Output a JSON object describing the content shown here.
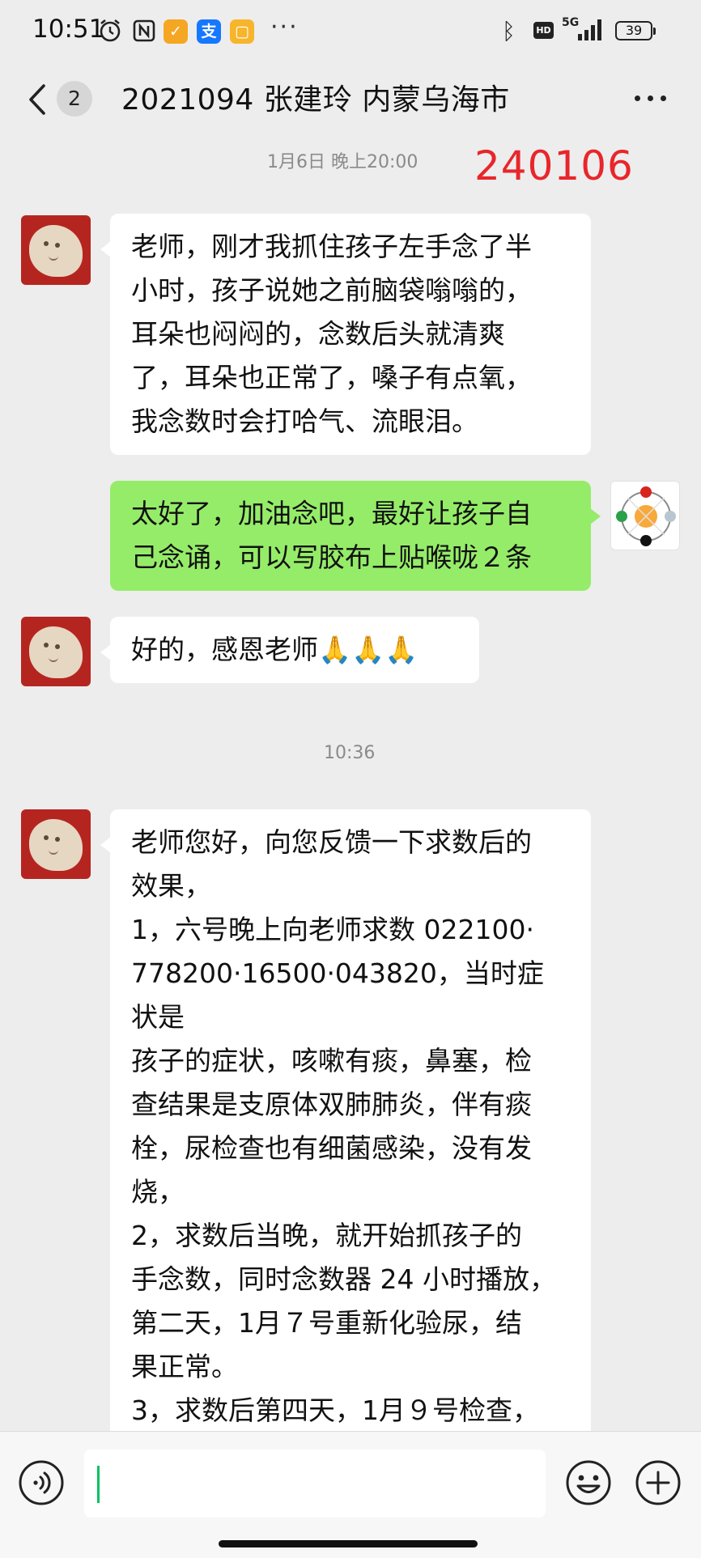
{
  "status_bar": {
    "time": "10:51",
    "app_badge_1": "✓",
    "app_badge_2": "支",
    "app_badge_3": "▢",
    "more": "···",
    "bluetooth": "ᛒ",
    "hd": "HD",
    "network": "5G",
    "battery": "39"
  },
  "header": {
    "unread_count": "2",
    "title": "2021094   张建玲  内蒙乌海市"
  },
  "timestamps": {
    "first": "1月6日 晚上20:00",
    "second": "10:36"
  },
  "stamp": "240106",
  "messages": [
    {
      "sender": "user",
      "lines": [
        "老师，刚才我抓住孩子左手念了半",
        "小时，孩子说她之前脑袋嗡嗡的，",
        "耳朵也闷闷的，念数后头就清爽",
        "了，耳朵也正常了，嗓子有点氧，",
        "我念数时会打哈气、流眼泪。"
      ]
    },
    {
      "sender": "teacher",
      "lines": [
        "太好了，加油念吧，最好让孩子自",
        "己念诵，可以写胶布上贴喉咙２条"
      ]
    },
    {
      "sender": "user",
      "lines": [
        "好的，感恩老师🙏🙏🙏"
      ]
    },
    {
      "sender": "user",
      "lines": [
        "老师您好，向您反馈一下求数后的",
        "效果，",
        "1，六号晚上向老师求数 022100·",
        "778200·16500·043820，当时症",
        "状是",
        "孩子的症状，咳嗽有痰，鼻塞，检",
        "查结果是支原体双肺肺炎，伴有痰",
        "栓，尿检查也有细菌感染，没有发",
        "烧，",
        "2，求数后当晚，就开始抓孩子的",
        "手念数，同时念数器 24 小时播放，",
        "第二天，1月７号重新化验尿，结",
        "果正常。",
        "3，求数后第四天，1月９号检查，"
      ]
    }
  ],
  "input": {
    "value": ""
  }
}
